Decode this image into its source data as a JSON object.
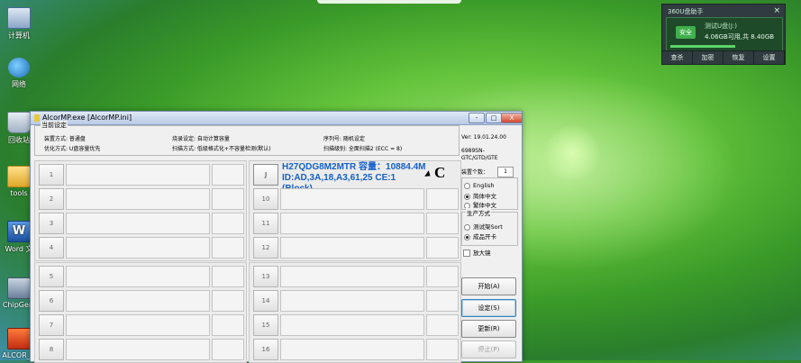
{
  "desktop": {
    "icons": [
      {
        "label": "计算机"
      },
      {
        "label": "网络"
      },
      {
        "label": "回收站"
      },
      {
        "label": "tools"
      },
      {
        "label": "Word 文"
      },
      {
        "label": "ChipGeni"
      },
      {
        "label": "ALCOR_U"
      }
    ]
  },
  "widget360": {
    "title": "360U盘助手",
    "close": "×",
    "safe_badge": "安全",
    "device_name": "测试U盘(J:)",
    "device_size": "4.06GB可用,共 8.40GB",
    "toolbar": [
      "查杀",
      "加密",
      "恢复",
      "设置"
    ]
  },
  "app": {
    "title": "AlcorMP.exe [AlcorMP.ini]",
    "window_buttons": {
      "minimize": "-",
      "maximize": "□",
      "close": "X"
    },
    "settings_group": {
      "label": "当前设定",
      "fields": [
        "装置方式: 普通盘",
        "烧录设定: 自动计算容量",
        "序列号: 随机设定",
        "优化方式: U盘容量优先",
        "扫描方式: 低级格式化+不容量检测(默认)",
        "扫描级别: 全面扫描2 (ECC = 8)"
      ]
    },
    "ports": {
      "panel1": [
        "1",
        "2",
        "3",
        "4"
      ],
      "panel2_active": "J",
      "panel2_rest": [
        "10",
        "11",
        "12"
      ],
      "panel3": [
        "5",
        "6",
        "7",
        "8"
      ],
      "panel4": [
        "13",
        "14",
        "15",
        "16"
      ]
    },
    "active_device": {
      "line1": "H27QDG8M2MTR 容量：10884.4M",
      "line2": "ID:AD,3A,18,A3,61,25 CE:1 (Block)",
      "flag": "C"
    },
    "side": {
      "version": "Ver: 19.01.24.00",
      "chip": "6989SN-GTC/GTD/GTE",
      "count_label": "装置个数：",
      "count_value": "1",
      "language": {
        "english": "English",
        "simplified": "简体中文",
        "traditional": "繁体中文"
      },
      "mode_group": {
        "label": "生产方式",
        "test": "测试架Sort",
        "product": "成品开卡"
      },
      "magnify": "放大镜",
      "buttons": {
        "start": "开始(A)",
        "settings": "设定(S)",
        "update": "更新(R)",
        "stop": "停止(P)"
      }
    }
  }
}
